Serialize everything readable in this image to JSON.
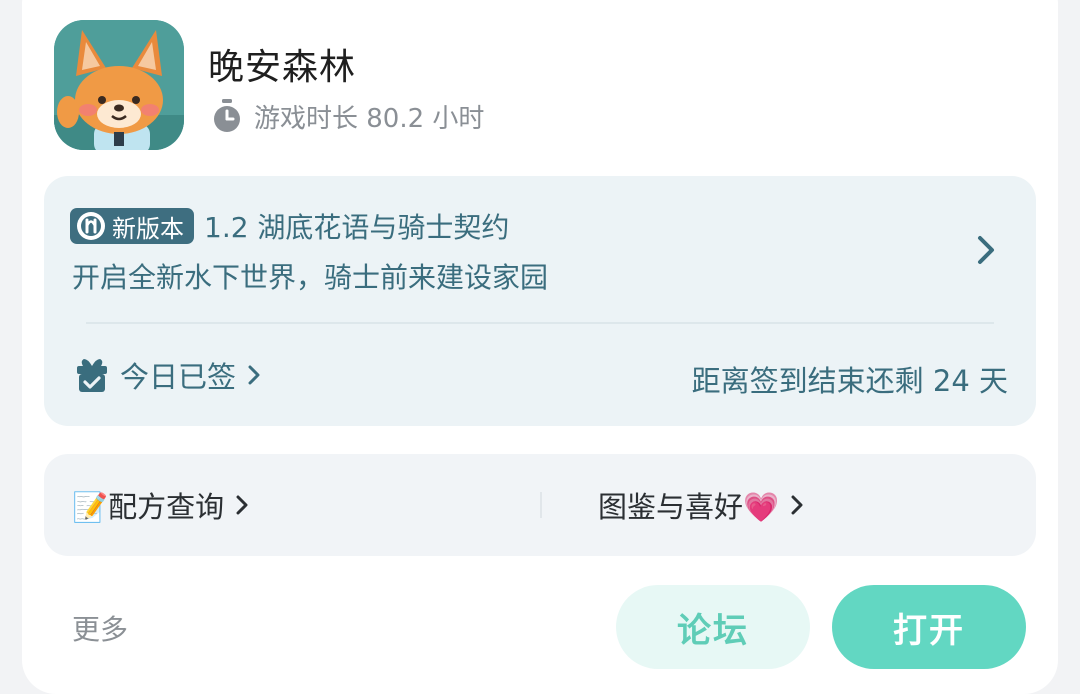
{
  "app": {
    "name": "晚安森林",
    "playtime": "游戏时长 80.2 小时",
    "icon": "fox-app-icon"
  },
  "version": {
    "badge": "新版本",
    "title": "1.2 湖底花语与骑士契约",
    "subtitle": "开启全新水下世界，骑士前来建设家园"
  },
  "signin": {
    "status": "今日已签",
    "countdown": "距离签到结束还剩 24 天"
  },
  "links": {
    "recipe": "📝配方查询",
    "gallery": "图鉴与喜好💗"
  },
  "actions": {
    "more": "更多",
    "forum": "论坛",
    "open": "打开"
  },
  "colors": {
    "accent": "#62d7c2",
    "panel_text": "#3a6d7e",
    "badge_bg": "#3e6e80"
  }
}
